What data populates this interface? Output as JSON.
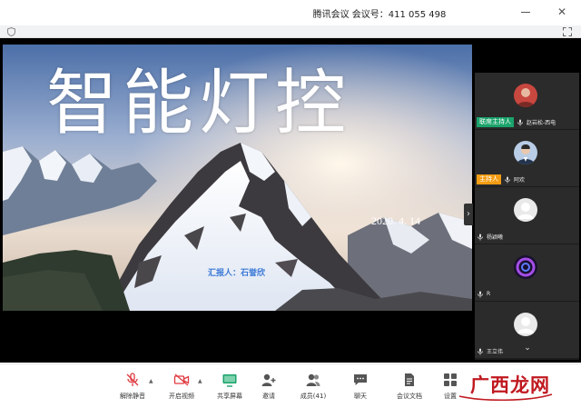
{
  "window": {
    "title": "腾讯会议 会议号：411 055 498",
    "minimize_icon": "minimize-icon",
    "close_icon": "close-icon",
    "close_glyph": "✕"
  },
  "topbar": {
    "left_icon": "shield-icon",
    "right_icon": "fullscreen-icon"
  },
  "slide": {
    "title": "智能灯控",
    "date": "2020. 4. 14",
    "presenter": "汇报人：石誉欣"
  },
  "panel": {
    "collapse_glyph": "›",
    "scroll_glyph": "⌄",
    "participants": [
      {
        "role": "联席主持人",
        "name": "赵岩松-西电",
        "role_color": "#1aa36b",
        "avatar": "photo-red"
      },
      {
        "role": "主持人",
        "name": "阿欢",
        "role_color": "#f39c12",
        "avatar": "photo-suit"
      },
      {
        "role": "",
        "name": "杨颖曦",
        "avatar": "default-user"
      },
      {
        "role": "",
        "name": "R",
        "avatar": "purple-swirl"
      },
      {
        "role": "",
        "name": "王立伟",
        "avatar": "default-user"
      }
    ]
  },
  "toolbar": {
    "mute": {
      "label": "解除静音",
      "icon": "mic-muted-icon"
    },
    "video": {
      "label": "开启视频",
      "icon": "video-off-icon"
    },
    "share": {
      "label": "共享屏幕",
      "icon": "share-screen-icon"
    },
    "invite": {
      "label": "邀请",
      "icon": "invite-icon"
    },
    "members": {
      "label": "成员(41)",
      "icon": "members-icon"
    },
    "chat": {
      "label": "聊天",
      "icon": "chat-icon"
    },
    "docs": {
      "label": "会议文档",
      "icon": "document-icon"
    },
    "settings": {
      "label": "设置",
      "icon": "apps-icon"
    },
    "caret": "▲"
  },
  "watermark": {
    "text": "广西龙网"
  },
  "colors": {
    "accent_red": "#e0393e",
    "share_green": "#1aa36b",
    "cohost_green": "#1aa36b",
    "host_orange": "#f39c12",
    "presenter_blue": "#3a78d6",
    "watermark_red": "#c01920"
  }
}
